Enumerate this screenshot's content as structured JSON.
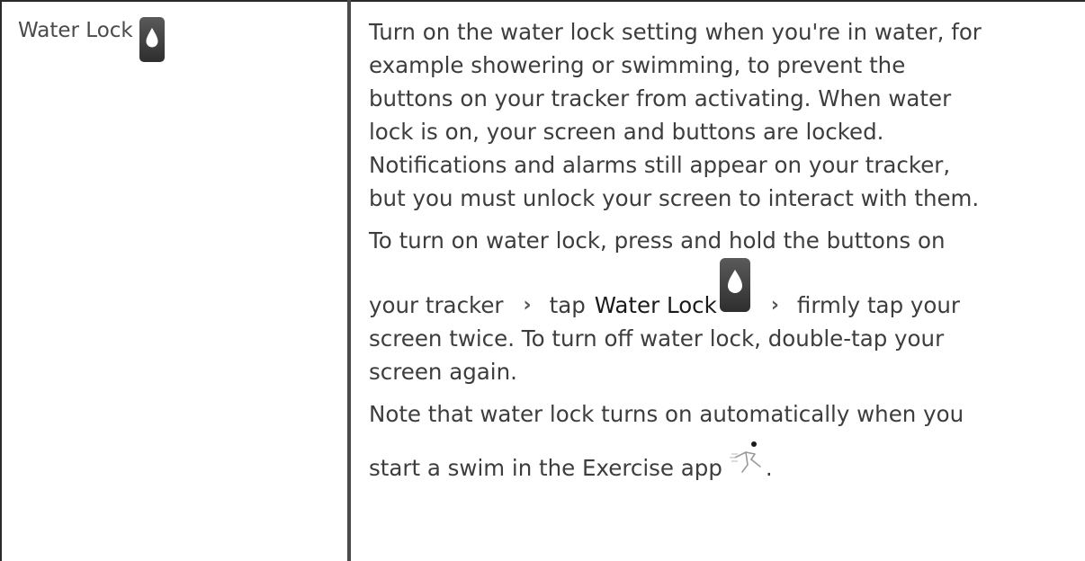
{
  "left_cell": {
    "title": "Water Lock",
    "icon": "water-drop-icon"
  },
  "right_cell": {
    "para1_lines": [
      "Turn on the water lock setting when you're in water, for",
      "example showering or swimming, to prevent the",
      "buttons on your tracker from activating. When water",
      "lock is on, your screen and buttons are locked.",
      "Notifications and alarms still appear on your tracker,",
      "but you must unlock your screen to interact with them."
    ],
    "para2_line1": "To turn on water lock, press and hold the buttons on",
    "para2_seg_a": "your tracker",
    "para2_seg_b": "tap",
    "para2_bold": "Water Lock",
    "para2_seg_c": "firmly tap your",
    "para2_line3": "screen twice. To turn off water lock, double-tap your",
    "para2_line4": "screen again.",
    "para3_line1": "Note that water lock turns on automatically when you",
    "para3_line2": "start a swim in the Exercise app",
    "para3_end": ".",
    "chevron_glyph": "›"
  },
  "colors": {
    "icon_dark": "#3b3b3b",
    "border": "#2a2a2a",
    "text": "#3d3d3d"
  }
}
